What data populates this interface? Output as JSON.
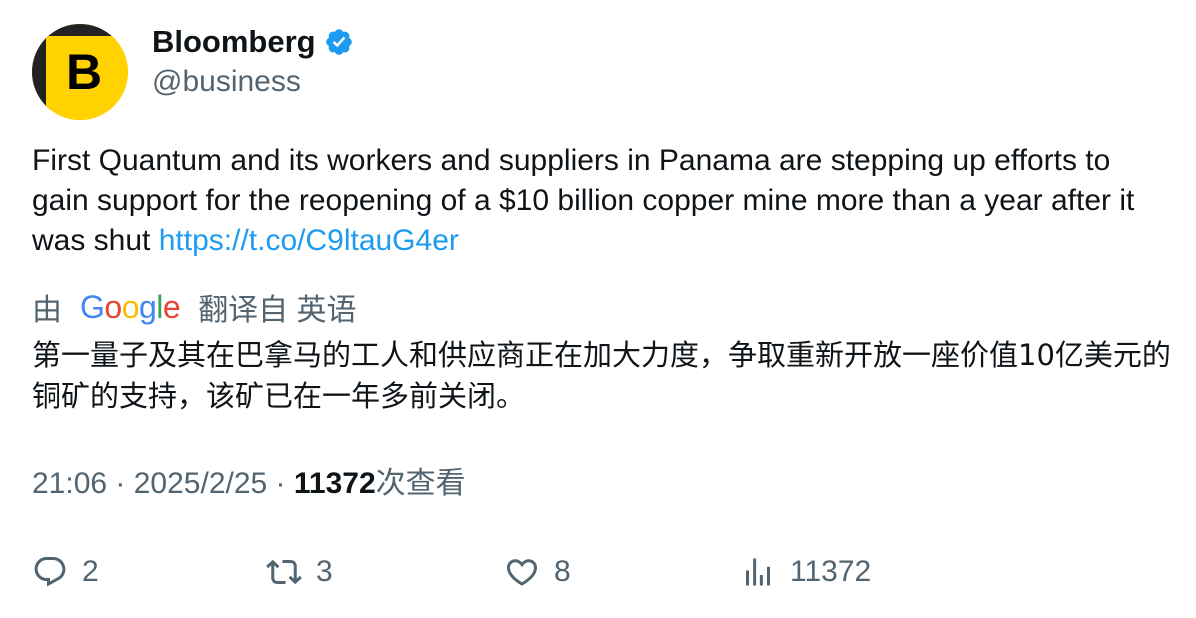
{
  "author": {
    "avatar_letter": "B",
    "name": "Bloomberg",
    "handle": "@business"
  },
  "tweet": {
    "text": "First Quantum and its workers and suppliers in Panama are stepping up efforts to gain support for the reopening of a $10 billion copper mine more than a year after it was shut ",
    "link": "https://t.co/C9ltauG4er"
  },
  "translation": {
    "prefix": "由",
    "google": [
      "G",
      "o",
      "o",
      "g",
      "l",
      "e"
    ],
    "suffix": "翻译自 英语",
    "text": "第一量子及其在巴拿马的工人和供应商正在加大力度，争取重新开放一座价值10亿美元的铜矿的支持，该矿已在一年多前关闭。"
  },
  "meta": {
    "time": "21:06",
    "sep1": " · ",
    "date": "2025/2/25",
    "sep2": " · ",
    "views": "11372",
    "views_label": "次查看"
  },
  "actions": {
    "reply_count": "2",
    "retweet_count": "3",
    "like_count": "8",
    "views_count": "11372"
  },
  "colors": {
    "link": "#1d9bf0",
    "verified": "#1d9bf0",
    "secondary_text": "#536471",
    "primary_text": "#0f1419",
    "google_blue": "#4285f4",
    "google_red": "#ea4335",
    "google_yellow": "#fbbc05",
    "google_green": "#34a853",
    "avatar_yellow": "#ffd200"
  },
  "icons": {
    "verified": "verified-badge-icon",
    "reply": "reply-icon",
    "retweet": "retweet-icon",
    "like": "heart-icon",
    "views": "analytics-icon"
  }
}
